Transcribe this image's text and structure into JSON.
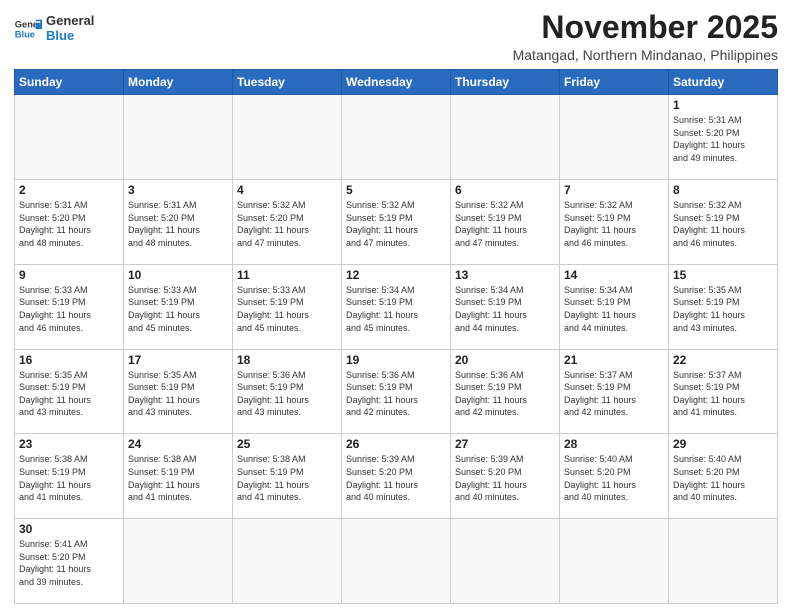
{
  "header": {
    "logo_general": "General",
    "logo_blue": "Blue",
    "month": "November 2025",
    "location": "Matangad, Northern Mindanao, Philippines"
  },
  "weekdays": [
    "Sunday",
    "Monday",
    "Tuesday",
    "Wednesday",
    "Thursday",
    "Friday",
    "Saturday"
  ],
  "weeks": [
    [
      {
        "day": "",
        "info": ""
      },
      {
        "day": "",
        "info": ""
      },
      {
        "day": "",
        "info": ""
      },
      {
        "day": "",
        "info": ""
      },
      {
        "day": "",
        "info": ""
      },
      {
        "day": "",
        "info": ""
      },
      {
        "day": "1",
        "info": "Sunrise: 5:31 AM\nSunset: 5:20 PM\nDaylight: 11 hours\nand 49 minutes."
      }
    ],
    [
      {
        "day": "2",
        "info": "Sunrise: 5:31 AM\nSunset: 5:20 PM\nDaylight: 11 hours\nand 48 minutes."
      },
      {
        "day": "3",
        "info": "Sunrise: 5:31 AM\nSunset: 5:20 PM\nDaylight: 11 hours\nand 48 minutes."
      },
      {
        "day": "4",
        "info": "Sunrise: 5:32 AM\nSunset: 5:20 PM\nDaylight: 11 hours\nand 47 minutes."
      },
      {
        "day": "5",
        "info": "Sunrise: 5:32 AM\nSunset: 5:19 PM\nDaylight: 11 hours\nand 47 minutes."
      },
      {
        "day": "6",
        "info": "Sunrise: 5:32 AM\nSunset: 5:19 PM\nDaylight: 11 hours\nand 47 minutes."
      },
      {
        "day": "7",
        "info": "Sunrise: 5:32 AM\nSunset: 5:19 PM\nDaylight: 11 hours\nand 46 minutes."
      },
      {
        "day": "8",
        "info": "Sunrise: 5:32 AM\nSunset: 5:19 PM\nDaylight: 11 hours\nand 46 minutes."
      }
    ],
    [
      {
        "day": "9",
        "info": "Sunrise: 5:33 AM\nSunset: 5:19 PM\nDaylight: 11 hours\nand 46 minutes."
      },
      {
        "day": "10",
        "info": "Sunrise: 5:33 AM\nSunset: 5:19 PM\nDaylight: 11 hours\nand 45 minutes."
      },
      {
        "day": "11",
        "info": "Sunrise: 5:33 AM\nSunset: 5:19 PM\nDaylight: 11 hours\nand 45 minutes."
      },
      {
        "day": "12",
        "info": "Sunrise: 5:34 AM\nSunset: 5:19 PM\nDaylight: 11 hours\nand 45 minutes."
      },
      {
        "day": "13",
        "info": "Sunrise: 5:34 AM\nSunset: 5:19 PM\nDaylight: 11 hours\nand 44 minutes."
      },
      {
        "day": "14",
        "info": "Sunrise: 5:34 AM\nSunset: 5:19 PM\nDaylight: 11 hours\nand 44 minutes."
      },
      {
        "day": "15",
        "info": "Sunrise: 5:35 AM\nSunset: 5:19 PM\nDaylight: 11 hours\nand 43 minutes."
      }
    ],
    [
      {
        "day": "16",
        "info": "Sunrise: 5:35 AM\nSunset: 5:19 PM\nDaylight: 11 hours\nand 43 minutes."
      },
      {
        "day": "17",
        "info": "Sunrise: 5:35 AM\nSunset: 5:19 PM\nDaylight: 11 hours\nand 43 minutes."
      },
      {
        "day": "18",
        "info": "Sunrise: 5:36 AM\nSunset: 5:19 PM\nDaylight: 11 hours\nand 43 minutes."
      },
      {
        "day": "19",
        "info": "Sunrise: 5:36 AM\nSunset: 5:19 PM\nDaylight: 11 hours\nand 42 minutes."
      },
      {
        "day": "20",
        "info": "Sunrise: 5:36 AM\nSunset: 5:19 PM\nDaylight: 11 hours\nand 42 minutes."
      },
      {
        "day": "21",
        "info": "Sunrise: 5:37 AM\nSunset: 5:19 PM\nDaylight: 11 hours\nand 42 minutes."
      },
      {
        "day": "22",
        "info": "Sunrise: 5:37 AM\nSunset: 5:19 PM\nDaylight: 11 hours\nand 41 minutes."
      }
    ],
    [
      {
        "day": "23",
        "info": "Sunrise: 5:38 AM\nSunset: 5:19 PM\nDaylight: 11 hours\nand 41 minutes."
      },
      {
        "day": "24",
        "info": "Sunrise: 5:38 AM\nSunset: 5:19 PM\nDaylight: 11 hours\nand 41 minutes."
      },
      {
        "day": "25",
        "info": "Sunrise: 5:38 AM\nSunset: 5:19 PM\nDaylight: 11 hours\nand 41 minutes."
      },
      {
        "day": "26",
        "info": "Sunrise: 5:39 AM\nSunset: 5:20 PM\nDaylight: 11 hours\nand 40 minutes."
      },
      {
        "day": "27",
        "info": "Sunrise: 5:39 AM\nSunset: 5:20 PM\nDaylight: 11 hours\nand 40 minutes."
      },
      {
        "day": "28",
        "info": "Sunrise: 5:40 AM\nSunset: 5:20 PM\nDaylight: 11 hours\nand 40 minutes."
      },
      {
        "day": "29",
        "info": "Sunrise: 5:40 AM\nSunset: 5:20 PM\nDaylight: 11 hours\nand 40 minutes."
      }
    ],
    [
      {
        "day": "30",
        "info": "Sunrise: 5:41 AM\nSunset: 5:20 PM\nDaylight: 11 hours\nand 39 minutes."
      },
      {
        "day": "",
        "info": ""
      },
      {
        "day": "",
        "info": ""
      },
      {
        "day": "",
        "info": ""
      },
      {
        "day": "",
        "info": ""
      },
      {
        "day": "",
        "info": ""
      },
      {
        "day": "",
        "info": ""
      }
    ]
  ]
}
